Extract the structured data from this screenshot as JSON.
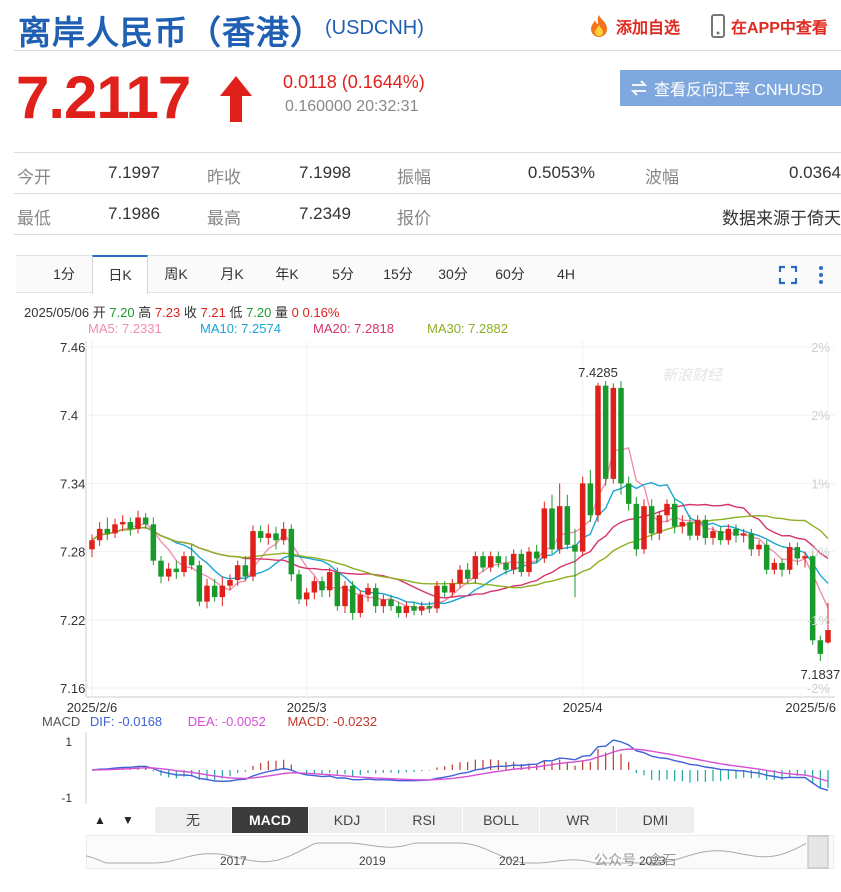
{
  "header": {
    "title": "离岸人民币（香港）",
    "code": "(USDCNH)",
    "add_favorite": "添加自选",
    "view_in_app": "在APP中查看"
  },
  "quote": {
    "price": "7.2117",
    "change": "0.0118 (0.1644%)",
    "sub": "0.160000 20:32:31",
    "reverse_button": "查看反向汇率 CNHUSD"
  },
  "stats": {
    "row1": [
      {
        "label": "今开",
        "value": "7.1997"
      },
      {
        "label": "昨收",
        "value": "7.1998"
      },
      {
        "label": "振幅",
        "value": "0.5053%"
      },
      {
        "label": "波幅",
        "value": "0.0364"
      }
    ],
    "row2": [
      {
        "label": "最低",
        "value": "7.1986"
      },
      {
        "label": "最高",
        "value": "7.2349"
      },
      {
        "label": "报价",
        "value": "数据来源于倚天"
      }
    ]
  },
  "tabs": [
    "1分",
    "日K",
    "周K",
    "月K",
    "年K",
    "5分",
    "15分",
    "30分",
    "60分",
    "4H"
  ],
  "active_tab": "日K",
  "bar_info": {
    "date": "2025/05/06",
    "open_label": "开",
    "open": "7.20",
    "high_label": "高",
    "high": "7.23",
    "close_label": "收",
    "close": "7.21",
    "low_label": "低",
    "low": "7.20",
    "vol_label": "量",
    "vol": "0",
    "pct": "0.16%"
  },
  "ma_legend": [
    {
      "text": "MA5: 7.2331",
      "color": "#f28fae"
    },
    {
      "text": "MA10: 7.2574",
      "color": "#1aa6d6"
    },
    {
      "text": "MA20: 7.2818",
      "color": "#d6336c"
    },
    {
      "text": "MA30: 7.2882",
      "color": "#8cb021"
    }
  ],
  "macd_legend": {
    "title": "MACD",
    "dif": "DIF: -0.0168",
    "dea": "DEA: -0.0052",
    "macd": "MACD: -0.0232"
  },
  "indicator_buttons": [
    "无",
    "MACD",
    "KDJ",
    "RSI",
    "BOLL",
    "WR",
    "DMI"
  ],
  "active_indicator": "MACD",
  "nav_arrows": [
    "▲",
    "▼"
  ],
  "overview_years": [
    "2017",
    "2019",
    "2021",
    "2023"
  ],
  "watermark": "新浪财经",
  "footer_mark": "公众号 · 金石",
  "colors": {
    "up": "#e0211b",
    "down": "#1a9a2d",
    "accent": "#1f5fb4",
    "button": "#7fa8de"
  },
  "chart_data": {
    "type": "candlestick",
    "y_ticks": [
      "7.46",
      "7.4",
      "7.34",
      "7.28",
      "7.22",
      "7.16"
    ],
    "y_ticks_right": [
      "2%",
      "2%",
      "1%",
      "0%",
      "-1%",
      "-2%"
    ],
    "x_ticks": [
      "2025/2/6",
      "2025/3",
      "2025/4",
      "2025/5/6"
    ],
    "ylim": [
      7.16,
      7.46
    ],
    "annotations": [
      {
        "text": "7.4285",
        "value": 7.4285
      },
      {
        "text": "7.1837",
        "value": 7.1837
      }
    ],
    "candles": [
      [
        7.282,
        7.29,
        7.275,
        7.295
      ],
      [
        7.29,
        7.3,
        7.285,
        7.306
      ],
      [
        7.3,
        7.296,
        7.29,
        7.31
      ],
      [
        7.296,
        7.304,
        7.292,
        7.309
      ],
      [
        7.304,
        7.306,
        7.298,
        7.312
      ],
      [
        7.306,
        7.3,
        7.294,
        7.31
      ],
      [
        7.3,
        7.31,
        7.296,
        7.316
      ],
      [
        7.31,
        7.304,
        7.3,
        7.314
      ],
      [
        7.304,
        7.272,
        7.268,
        7.31
      ],
      [
        7.272,
        7.258,
        7.252,
        7.276
      ],
      [
        7.258,
        7.265,
        7.254,
        7.27
      ],
      [
        7.265,
        7.262,
        7.256,
        7.272
      ],
      [
        7.262,
        7.276,
        7.258,
        7.28
      ],
      [
        7.276,
        7.268,
        7.264,
        7.286
      ],
      [
        7.268,
        7.236,
        7.232,
        7.272
      ],
      [
        7.236,
        7.25,
        7.23,
        7.256
      ],
      [
        7.25,
        7.24,
        7.236,
        7.256
      ],
      [
        7.24,
        7.25,
        7.232,
        7.258
      ],
      [
        7.25,
        7.255,
        7.246,
        7.26
      ],
      [
        7.255,
        7.268,
        7.25,
        7.272
      ],
      [
        7.268,
        7.258,
        7.254,
        7.276
      ],
      [
        7.258,
        7.298,
        7.254,
        7.303
      ],
      [
        7.298,
        7.292,
        7.288,
        7.303
      ],
      [
        7.292,
        7.296,
        7.286,
        7.304
      ],
      [
        7.296,
        7.29,
        7.282,
        7.302
      ],
      [
        7.29,
        7.3,
        7.286,
        7.306
      ],
      [
        7.3,
        7.26,
        7.254,
        7.304
      ],
      [
        7.26,
        7.238,
        7.234,
        7.264
      ],
      [
        7.238,
        7.244,
        7.232,
        7.248
      ],
      [
        7.244,
        7.254,
        7.238,
        7.258
      ],
      [
        7.254,
        7.246,
        7.24,
        7.258
      ],
      [
        7.246,
        7.262,
        7.24,
        7.266
      ],
      [
        7.262,
        7.232,
        7.228,
        7.266
      ],
      [
        7.232,
        7.25,
        7.226,
        7.254
      ],
      [
        7.25,
        7.226,
        7.22,
        7.254
      ],
      [
        7.226,
        7.242,
        7.222,
        7.246
      ],
      [
        7.242,
        7.248,
        7.236,
        7.252
      ],
      [
        7.248,
        7.232,
        7.226,
        7.252
      ],
      [
        7.232,
        7.238,
        7.226,
        7.242
      ],
      [
        7.238,
        7.232,
        7.228,
        7.242
      ],
      [
        7.232,
        7.226,
        7.222,
        7.236
      ],
      [
        7.226,
        7.232,
        7.222,
        7.236
      ],
      [
        7.232,
        7.228,
        7.224,
        7.236
      ],
      [
        7.228,
        7.232,
        7.224,
        7.236
      ],
      [
        7.232,
        7.23,
        7.226,
        7.236
      ],
      [
        7.23,
        7.25,
        7.226,
        7.254
      ],
      [
        7.25,
        7.244,
        7.24,
        7.254
      ],
      [
        7.244,
        7.252,
        7.24,
        7.256
      ],
      [
        7.252,
        7.264,
        7.248,
        7.268
      ],
      [
        7.264,
        7.256,
        7.252,
        7.27
      ],
      [
        7.256,
        7.276,
        7.252,
        7.28
      ],
      [
        7.276,
        7.266,
        7.262,
        7.28
      ],
      [
        7.266,
        7.276,
        7.262,
        7.28
      ],
      [
        7.276,
        7.27,
        7.266,
        7.28
      ],
      [
        7.27,
        7.264,
        7.26,
        7.276
      ],
      [
        7.264,
        7.278,
        7.26,
        7.282
      ],
      [
        7.278,
        7.262,
        7.258,
        7.282
      ],
      [
        7.262,
        7.28,
        7.258,
        7.284
      ],
      [
        7.28,
        7.274,
        7.27,
        7.286
      ],
      [
        7.274,
        7.318,
        7.27,
        7.324
      ],
      [
        7.318,
        7.282,
        7.278,
        7.33
      ],
      [
        7.282,
        7.32,
        7.278,
        7.34
      ],
      [
        7.32,
        7.286,
        7.282,
        7.33
      ],
      [
        7.286,
        7.28,
        7.24,
        7.3
      ],
      [
        7.28,
        7.34,
        7.276,
        7.346
      ],
      [
        7.34,
        7.312,
        7.306,
        7.352
      ],
      [
        7.312,
        7.426,
        7.306,
        7.4285
      ],
      [
        7.426,
        7.344,
        7.338,
        7.43
      ],
      [
        7.344,
        7.424,
        7.34,
        7.428
      ],
      [
        7.424,
        7.34,
        7.33,
        7.43
      ],
      [
        7.34,
        7.322,
        7.316,
        7.346
      ],
      [
        7.322,
        7.282,
        7.276,
        7.328
      ],
      [
        7.282,
        7.32,
        7.278,
        7.326
      ],
      [
        7.32,
        7.296,
        7.29,
        7.326
      ],
      [
        7.296,
        7.312,
        7.29,
        7.316
      ],
      [
        7.312,
        7.322,
        7.306,
        7.326
      ],
      [
        7.322,
        7.302,
        7.296,
        7.326
      ],
      [
        7.302,
        7.306,
        7.296,
        7.312
      ],
      [
        7.306,
        7.294,
        7.29,
        7.312
      ],
      [
        7.294,
        7.308,
        7.29,
        7.312
      ],
      [
        7.308,
        7.292,
        7.286,
        7.312
      ],
      [
        7.292,
        7.298,
        7.286,
        7.302
      ],
      [
        7.298,
        7.29,
        7.286,
        7.302
      ],
      [
        7.29,
        7.3,
        7.286,
        7.304
      ],
      [
        7.3,
        7.294,
        7.288,
        7.304
      ],
      [
        7.294,
        7.296,
        7.288,
        7.3
      ],
      [
        7.296,
        7.282,
        7.276,
        7.3
      ],
      [
        7.282,
        7.286,
        7.276,
        7.29
      ],
      [
        7.286,
        7.264,
        7.26,
        7.29
      ],
      [
        7.264,
        7.27,
        7.26,
        7.274
      ],
      [
        7.27,
        7.264,
        7.258,
        7.274
      ],
      [
        7.264,
        7.284,
        7.26,
        7.288
      ],
      [
        7.284,
        7.274,
        7.268,
        7.288
      ],
      [
        7.274,
        7.276,
        7.266,
        7.28
      ],
      [
        7.276,
        7.202,
        7.198,
        7.28
      ],
      [
        7.202,
        7.19,
        7.1837,
        7.206
      ],
      [
        7.2,
        7.211,
        7.199,
        7.235
      ]
    ]
  }
}
